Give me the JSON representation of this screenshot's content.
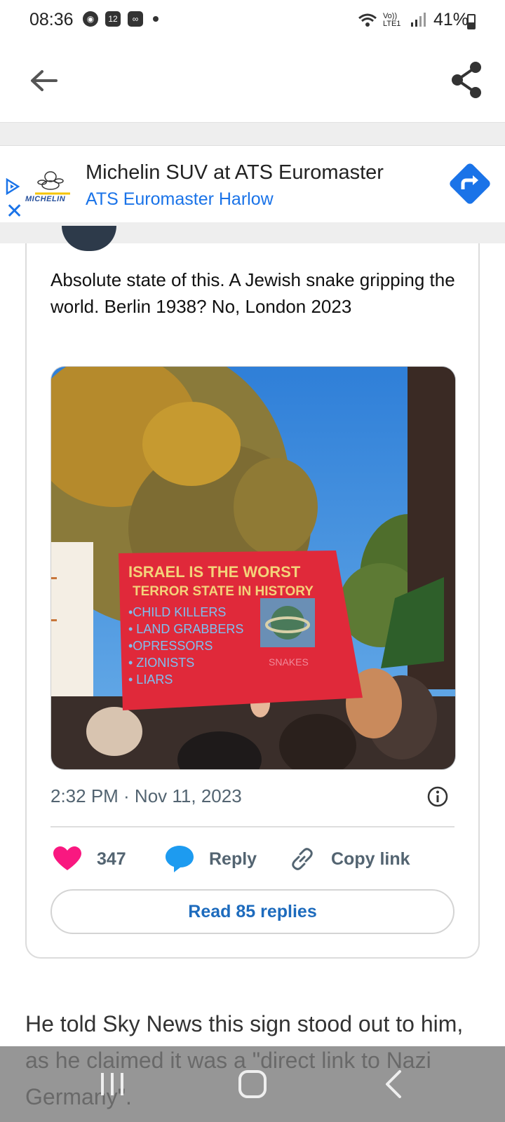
{
  "status_bar": {
    "time": "08:36",
    "battery": "41%",
    "icons": [
      "chrome-icon",
      "calendar-icon",
      "voicemail-icon",
      "wifi-icon",
      "volte-icon",
      "signal-icon",
      "battery-icon"
    ],
    "calendar_day": "12",
    "volte_label": "Vo)) LTE1"
  },
  "ad": {
    "headline": "Michelin SUV at ATS Euromaster",
    "subline": "ATS Euromaster Harlow",
    "brand": "MICHELIN",
    "accent": "#1a73e8"
  },
  "post": {
    "text": "Absolute state of this. A Jewish snake gripping the world. Berlin 1938? No, London 2023",
    "timestamp": "2:32 PM · Nov 11, 2023",
    "likes": "347",
    "reply_label": "Reply",
    "copy_link_label": "Copy link",
    "read_replies_label": "Read 85 replies",
    "sign_lines": [
      "ISRAEL IS THE WORST",
      "TERROR STATE IN HISTORY"
    ],
    "sign_items": [
      "•CHILD KILLERS",
      "• LAND GRABBERS",
      "•OPRESSORS",
      "• ZIONISTS",
      "• LIARS"
    ],
    "sign_small": "SNAKES",
    "like_color": "#f91880",
    "reply_color": "#1d9bf0"
  },
  "article": {
    "paragraph": "He told Sky News this sign stood out to him, as he claimed it was a \"direct link to Nazi Germany\"."
  }
}
